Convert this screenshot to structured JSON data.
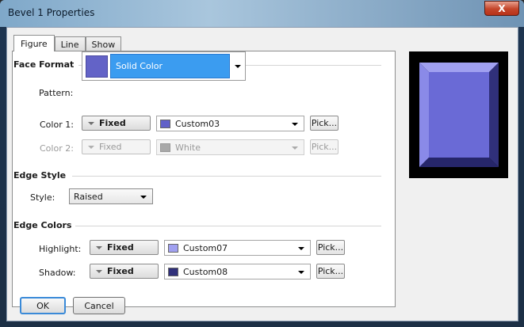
{
  "window": {
    "title": "Bevel 1 Properties",
    "close_label": "X"
  },
  "tabs": [
    {
      "label": "Figure",
      "active": true
    },
    {
      "label": "Line",
      "active": false
    },
    {
      "label": "Show",
      "active": false
    }
  ],
  "face_format": {
    "heading": "Face Format",
    "pattern_label": "Pattern:",
    "pattern_value": "Solid Color",
    "pattern_swatch_color": "#6363c7",
    "color1": {
      "label": "Color 1:",
      "mode": "Fixed",
      "value": "Custom03",
      "swatch": "#6060c8",
      "pick": "Pick..."
    },
    "color2": {
      "label": "Color 2:",
      "mode": "Fixed",
      "value": "White",
      "swatch": "#a8a8a8",
      "pick": "Pick...",
      "disabled": true
    }
  },
  "edge_style": {
    "heading": "Edge Style",
    "style_label": "Style:",
    "style_value": "Raised"
  },
  "edge_colors": {
    "heading": "Edge Colors",
    "highlight": {
      "label": "Highlight:",
      "mode": "Fixed",
      "value": "Custom07",
      "swatch": "#a0a0f0",
      "pick": "Pick..."
    },
    "shadow": {
      "label": "Shadow:",
      "mode": "Fixed",
      "value": "Custom08",
      "swatch": "#30307a",
      "pick": "Pick..."
    }
  },
  "buttons": {
    "ok": "OK",
    "cancel": "Cancel"
  },
  "preview": {
    "face_color": "#6a6ad6",
    "highlight_color": "#a0a0f0",
    "shadow_color": "#30307a"
  },
  "colors": {
    "selection": "#3b9cf0",
    "default_button_border": "#3a8ad8"
  }
}
